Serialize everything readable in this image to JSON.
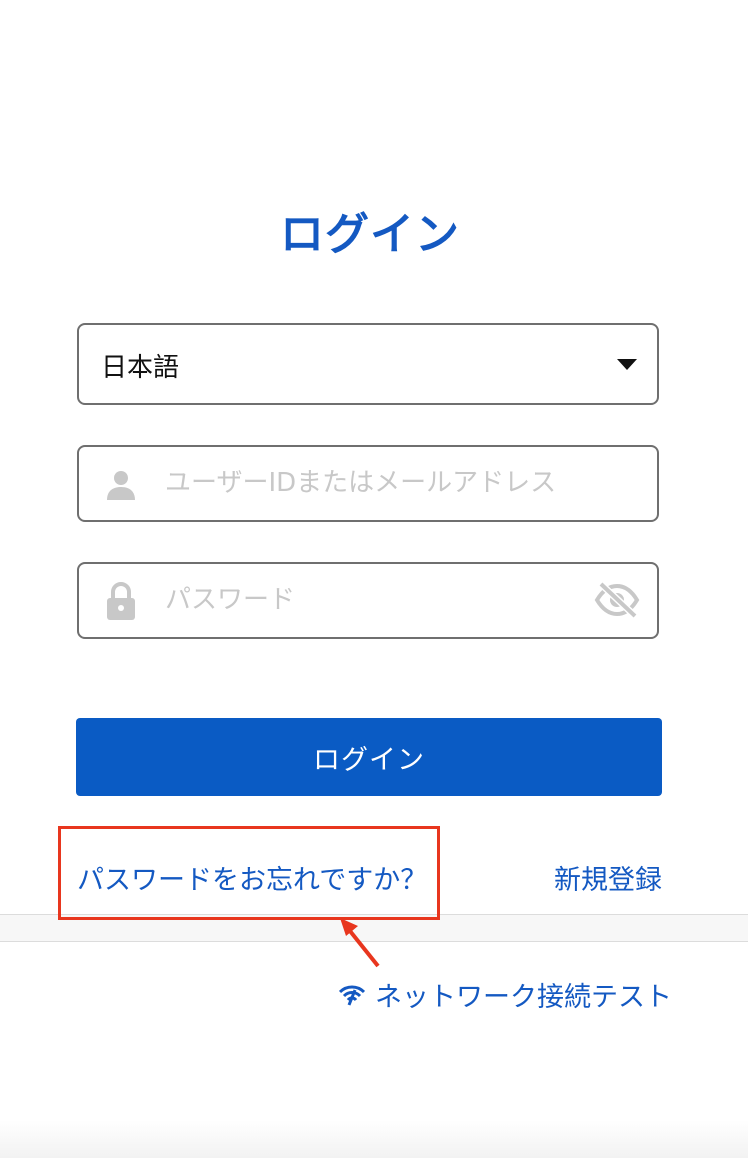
{
  "title": "ログイン",
  "language_select": {
    "value": "日本語",
    "icon": "chevron-down-icon"
  },
  "user_field": {
    "placeholder": "ユーザーIDまたはメールアドレス",
    "value": "",
    "icon": "user-icon"
  },
  "password_field": {
    "placeholder": "パスワード",
    "value": "",
    "icon": "lock-icon",
    "toggle_icon": "eye-off-icon"
  },
  "login_button": {
    "label": "ログイン"
  },
  "links": {
    "forgot_password": "パスワードをお忘れですか？",
    "register": "新規登録",
    "network_test": "ネットワーク接続テスト",
    "network_icon": "wifi-icon"
  },
  "colors": {
    "accent": "#1459c2",
    "button": "#0a5bc4",
    "annotation": "#e8361e"
  }
}
